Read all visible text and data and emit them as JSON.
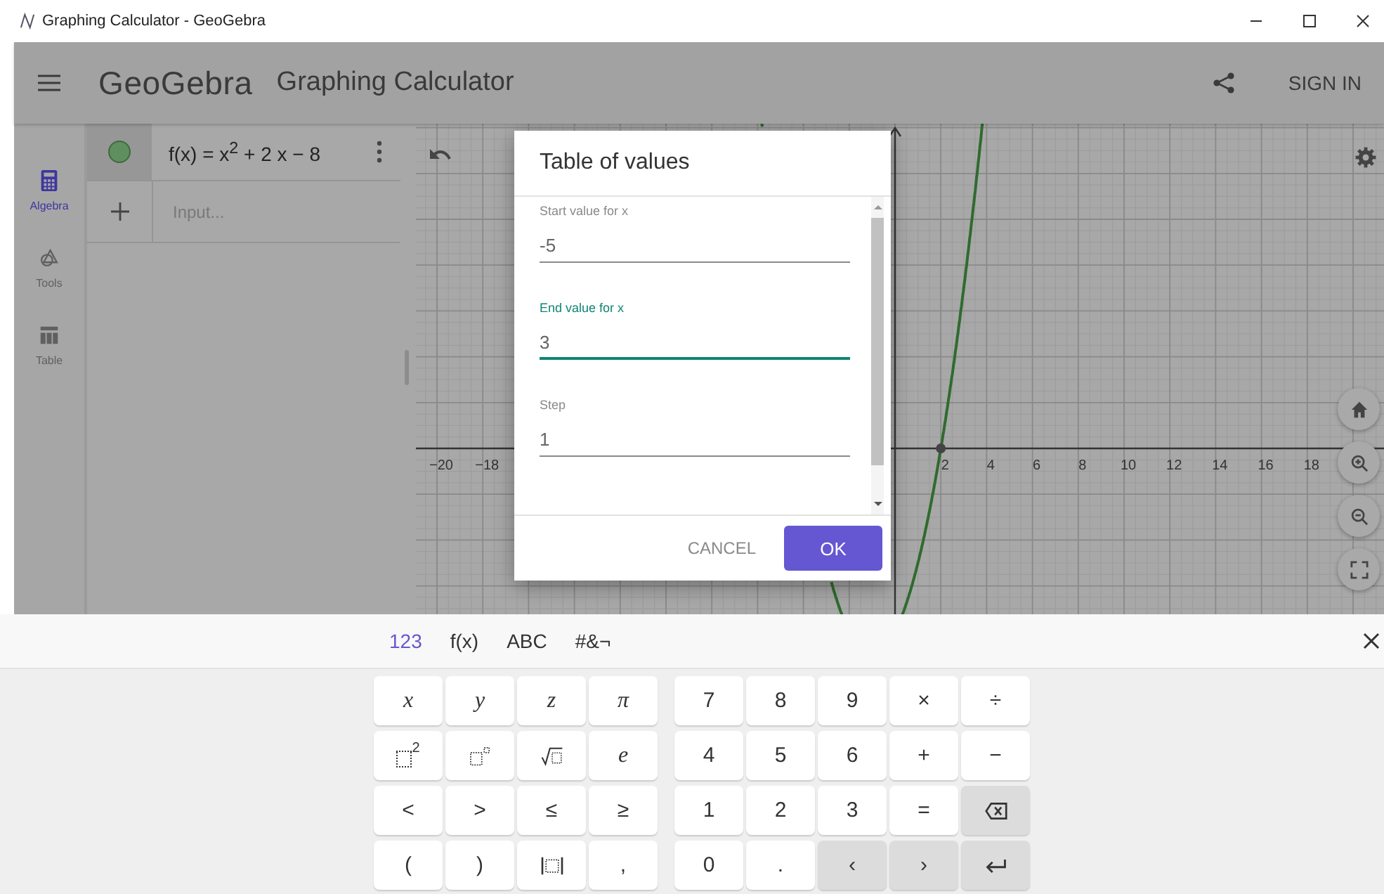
{
  "window": {
    "title": "Graphing Calculator - GeoGebra"
  },
  "header": {
    "logo": "GeoGebra",
    "app_title": "Graphing Calculator",
    "sign_in": "SIGN IN"
  },
  "rail": [
    {
      "label": "Algebra",
      "selected": true
    },
    {
      "label": "Tools",
      "selected": false
    },
    {
      "label": "Table",
      "selected": false
    }
  ],
  "algebra": {
    "entries": [
      {
        "formula": "f(x) = x$^{2}$ + 2 x − 8",
        "visible": true
      }
    ],
    "input_placeholder": "Input..."
  },
  "graphics": {
    "x_axis_labels": [
      "−20",
      "−18",
      "2",
      "4",
      "6",
      "8",
      "10",
      "12",
      "14",
      "16",
      "18"
    ]
  },
  "dialog": {
    "title": "Table of values",
    "fields": [
      {
        "label": "Start value for x",
        "value": "-5",
        "focused": false
      },
      {
        "label": "End value for x",
        "value": "3",
        "focused": true
      },
      {
        "label": "Step",
        "value": "1",
        "focused": false
      }
    ],
    "buttons": [
      {
        "label": "CANCEL",
        "kind": "text"
      },
      {
        "label": "OK",
        "kind": "primary"
      }
    ]
  },
  "keyboard": {
    "tabs": [
      {
        "label": "123",
        "selected": true
      },
      {
        "label": "f(x)",
        "selected": false
      },
      {
        "label": "ABC",
        "selected": false
      },
      {
        "label": "#&¬",
        "selected": false
      }
    ],
    "rows": [
      {
        "left": [
          {
            "kind": "letter",
            "label": "x"
          },
          {
            "kind": "letter",
            "label": "y"
          },
          {
            "kind": "letter",
            "label": "z"
          },
          {
            "kind": "letter",
            "label": "π"
          }
        ],
        "right": [
          {
            "kind": "symbol",
            "label": "7"
          },
          {
            "kind": "symbol",
            "label": "8"
          },
          {
            "kind": "symbol",
            "label": "9"
          },
          {
            "kind": "symbol",
            "label": "×"
          },
          {
            "kind": "symbol",
            "label": "÷"
          }
        ]
      },
      {
        "left": [
          {
            "kind": "square",
            "label": "2"
          },
          {
            "kind": "power"
          },
          {
            "kind": "sqrt"
          },
          {
            "kind": "letter",
            "label": "e"
          }
        ],
        "right": [
          {
            "kind": "symbol",
            "label": "4"
          },
          {
            "kind": "symbol",
            "label": "5"
          },
          {
            "kind": "symbol",
            "label": "6"
          },
          {
            "kind": "symbol",
            "label": "+"
          },
          {
            "kind": "symbol",
            "label": "−"
          }
        ]
      },
      {
        "left": [
          {
            "kind": "symbol",
            "label": "<"
          },
          {
            "kind": "symbol",
            "label": ">"
          },
          {
            "kind": "symbol",
            "label": "≤"
          },
          {
            "kind": "symbol",
            "label": "≥"
          }
        ],
        "right": [
          {
            "kind": "symbol",
            "label": "1"
          },
          {
            "kind": "symbol",
            "label": "2"
          },
          {
            "kind": "symbol",
            "label": "3"
          },
          {
            "kind": "symbol",
            "label": "="
          },
          {
            "kind": "backspace"
          }
        ]
      },
      {
        "left": [
          {
            "kind": "symbol",
            "label": "("
          },
          {
            "kind": "symbol",
            "label": ")"
          },
          {
            "kind": "abs"
          },
          {
            "kind": "symbol",
            "label": ","
          }
        ],
        "right": [
          {
            "kind": "symbol",
            "label": "0"
          },
          {
            "kind": "symbol",
            "label": "."
          },
          {
            "kind": "nav",
            "label": "‹"
          },
          {
            "kind": "nav",
            "label": "›"
          },
          {
            "kind": "enter"
          }
        ]
      }
    ]
  }
}
